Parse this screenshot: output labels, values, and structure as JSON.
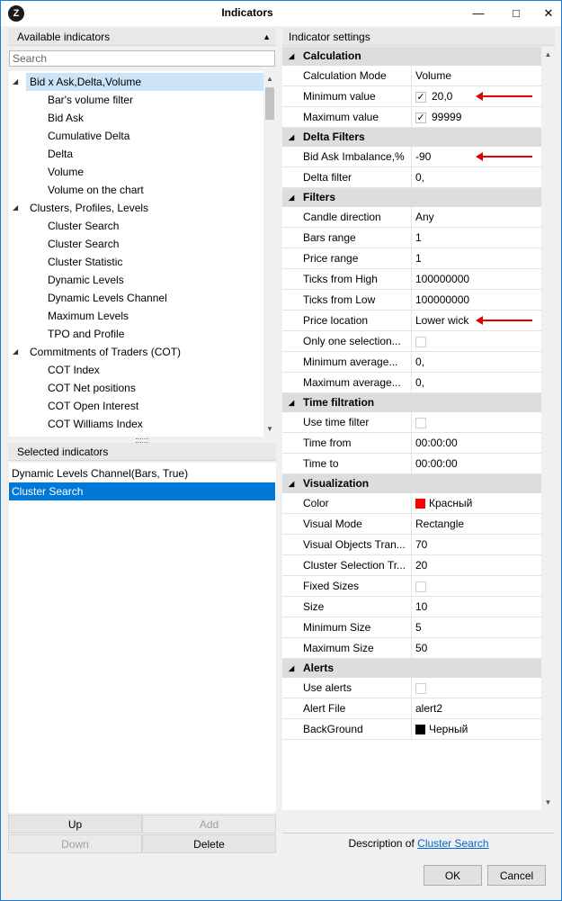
{
  "window": {
    "title": "Indicators",
    "minimize": "—",
    "maximize": "□",
    "close": "✕",
    "icon_letter": "Z"
  },
  "available_panel": {
    "header": "Available indicators",
    "search_placeholder": "Search",
    "tree": [
      {
        "label": "Bid x Ask,Delta,Volume",
        "level": 0,
        "expanded": true,
        "selected": true
      },
      {
        "label": "Bar's volume filter",
        "level": 1
      },
      {
        "label": "Bid Ask",
        "level": 1
      },
      {
        "label": "Cumulative Delta",
        "level": 1
      },
      {
        "label": "Delta",
        "level": 1
      },
      {
        "label": "Volume",
        "level": 1
      },
      {
        "label": "Volume on the chart",
        "level": 1
      },
      {
        "label": "Clusters, Profiles, Levels",
        "level": 0,
        "expanded": true
      },
      {
        "label": "Cluster Search",
        "level": 1
      },
      {
        "label": "Cluster Search",
        "level": 1
      },
      {
        "label": "Cluster Statistic",
        "level": 1
      },
      {
        "label": "Dynamic Levels",
        "level": 1
      },
      {
        "label": "Dynamic Levels Channel",
        "level": 1
      },
      {
        "label": "Maximum Levels",
        "level": 1
      },
      {
        "label": "TPO and Profile",
        "level": 1
      },
      {
        "label": "Commitments of Traders (COT)",
        "level": 0,
        "expanded": true
      },
      {
        "label": "COT Index",
        "level": 1
      },
      {
        "label": "COT Net positions",
        "level": 1
      },
      {
        "label": "COT Open Interest",
        "level": 1
      },
      {
        "label": "COT Williams Index",
        "level": 1
      }
    ]
  },
  "selected_panel": {
    "header": "Selected indicators",
    "items": [
      {
        "label": "Dynamic Levels Channel(Bars, True)",
        "active": false
      },
      {
        "label": "Cluster Search",
        "active": true
      }
    ],
    "buttons": {
      "up": "Up",
      "add": "Add",
      "down": "Down",
      "delete": "Delete"
    }
  },
  "settings_panel": {
    "header": "Indicator settings",
    "categories": [
      {
        "name": "Calculation",
        "rows": [
          {
            "name": "Calculation Mode",
            "value": "Volume"
          },
          {
            "name": "Minimum value",
            "value": "20,0",
            "checkbox": "checked",
            "arrow": true
          },
          {
            "name": "Maximum value",
            "value": "99999",
            "checkbox": "checked"
          }
        ]
      },
      {
        "name": "Delta Filters",
        "rows": [
          {
            "name": "Bid Ask Imbalance,%",
            "value": "-90",
            "arrow": true
          },
          {
            "name": "Delta filter",
            "value": "0,"
          }
        ]
      },
      {
        "name": "Filters",
        "rows": [
          {
            "name": "Candle direction",
            "value": "Any"
          },
          {
            "name": "Bars range",
            "value": "1"
          },
          {
            "name": "Price range",
            "value": "1"
          },
          {
            "name": "Ticks from High",
            "value": "100000000"
          },
          {
            "name": "Ticks from Low",
            "value": "100000000"
          },
          {
            "name": "Price location",
            "value": "Lower wick",
            "arrow": true
          },
          {
            "name": "Only one selection...",
            "value": "",
            "checkbox": "empty"
          },
          {
            "name": "Minimum average...",
            "value": "0,"
          },
          {
            "name": "Maximum average...",
            "value": "0,"
          }
        ]
      },
      {
        "name": "Time filtration",
        "rows": [
          {
            "name": "Use time filter",
            "value": "",
            "checkbox": "empty"
          },
          {
            "name": "Time from",
            "value": "00:00:00"
          },
          {
            "name": "Time to",
            "value": "00:00:00"
          }
        ]
      },
      {
        "name": "Visualization",
        "rows": [
          {
            "name": "Color",
            "value": "Красный",
            "swatch": "#ff0000"
          },
          {
            "name": "Visual Mode",
            "value": "Rectangle"
          },
          {
            "name": "Visual Objects Tran...",
            "value": "70"
          },
          {
            "name": "Cluster Selection Tr...",
            "value": "20"
          },
          {
            "name": "Fixed Sizes",
            "value": "",
            "checkbox": "empty"
          },
          {
            "name": "Size",
            "value": "10"
          },
          {
            "name": "Minimum Size",
            "value": "5"
          },
          {
            "name": "Maximum Size",
            "value": "50"
          }
        ]
      },
      {
        "name": "Alerts",
        "rows": [
          {
            "name": "Use alerts",
            "value": "",
            "checkbox": "empty"
          },
          {
            "name": "Alert File",
            "value": "alert2"
          },
          {
            "name": "BackGround",
            "value": "Черный",
            "swatch": "#000000"
          }
        ]
      }
    ],
    "description_prefix": "Description of ",
    "description_link": "Cluster Search"
  },
  "dialog_buttons": {
    "ok": "OK",
    "cancel": "Cancel"
  },
  "colors": {
    "accent": "#0078d7",
    "annotation_arrow": "#e00000",
    "window_border": "#1f7bd1"
  }
}
